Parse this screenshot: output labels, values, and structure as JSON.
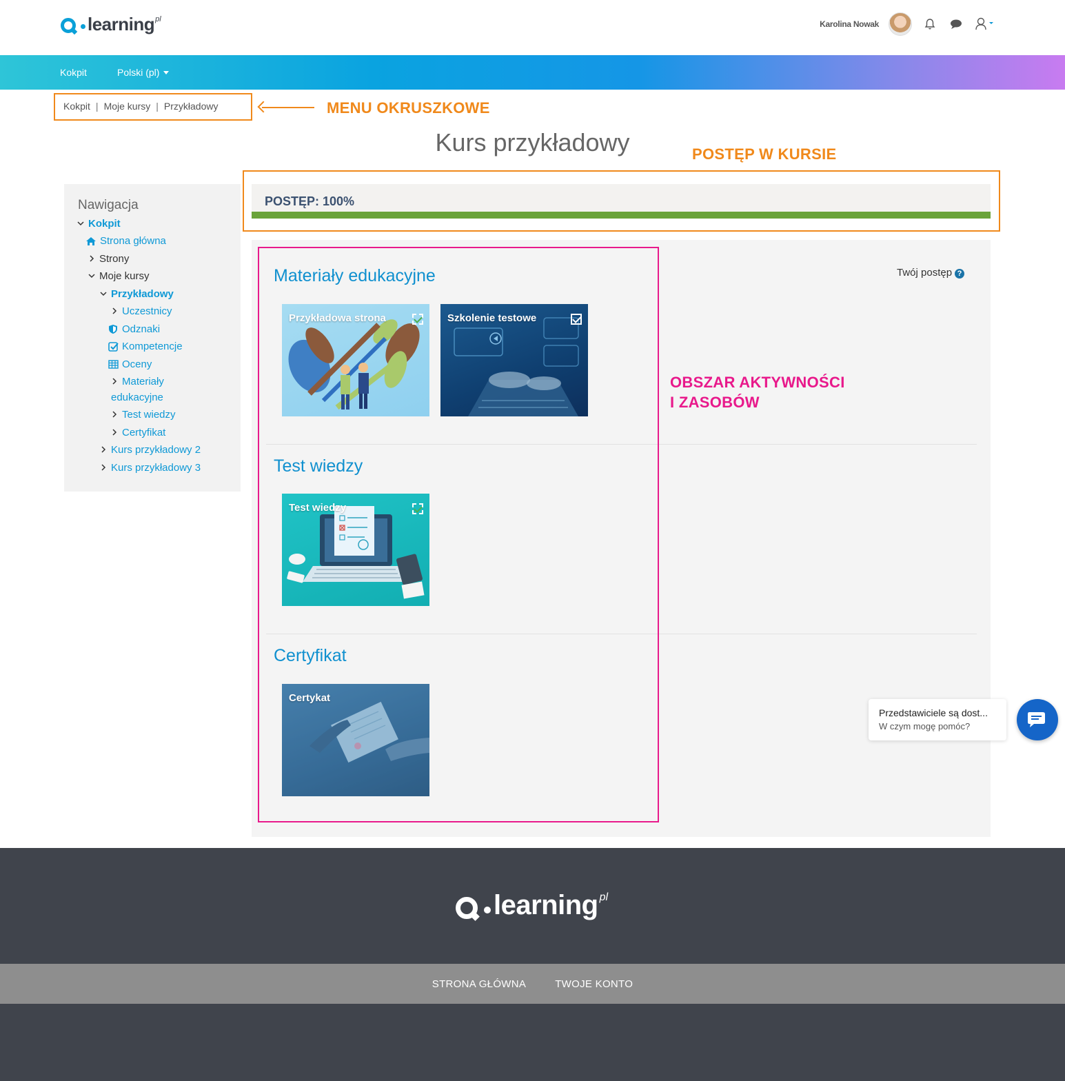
{
  "header": {
    "logo_word": "learning",
    "logo_suffix": "pl",
    "user_name": "Karolina Nowak"
  },
  "navbar": {
    "items": [
      {
        "label": "Kokpit"
      },
      {
        "label": "Polski (pl)"
      }
    ]
  },
  "breadcrumb": {
    "items": [
      "Kokpit",
      "Moje kursy",
      "Przykładowy"
    ]
  },
  "annotations": {
    "breadcrumb": "MENU OKRUSZKOWE",
    "progress": "POSTĘP W KURSIE",
    "activity_line1": "OBSZAR AKTYWNOŚCI",
    "activity_line2": "I ZASOBÓW"
  },
  "page": {
    "title": "Kurs przykładowy"
  },
  "progress": {
    "label": "POSTĘP: 100%",
    "value": 1.0,
    "color": "#6aa33a"
  },
  "sidebar": {
    "title": "Nawigacja",
    "items": [
      {
        "label": "Kokpit"
      },
      {
        "label": "Strona główna"
      },
      {
        "label": "Strony"
      },
      {
        "label": "Moje kursy"
      },
      {
        "label": "Przykładowy"
      },
      {
        "label": "Uczestnicy"
      },
      {
        "label": "Odznaki"
      },
      {
        "label": "Kompetencje"
      },
      {
        "label": "Oceny"
      },
      {
        "label": "Materiały"
      },
      {
        "label": "edukacyjne"
      },
      {
        "label": "Test wiedzy"
      },
      {
        "label": "Certyfikat"
      },
      {
        "label": "Kurs przykładowy 2"
      },
      {
        "label": "Kurs przykładowy 3"
      }
    ]
  },
  "main": {
    "your_progress": "Twój postęp",
    "help": "?",
    "sections": [
      {
        "title": "Materiały edukacyjne",
        "tiles": [
          {
            "label": "Przykładowa strona",
            "completed": true
          },
          {
            "label": "Szkolenie testowe",
            "completed": true
          }
        ]
      },
      {
        "title": "Test wiedzy",
        "tiles": [
          {
            "label": "Test wiedzy",
            "completed": true
          }
        ]
      },
      {
        "title": "Certyfikat",
        "tiles": [
          {
            "label": "Certykat"
          }
        ]
      }
    ]
  },
  "chat": {
    "title": "Przedstawiciele są dost...",
    "subtitle": "W czym mogę pomóc?"
  },
  "footer": {
    "logo_word": "learning",
    "logo_suffix": "pl",
    "links": [
      "STRONA GŁÓWNA",
      "TWOJE KONTO"
    ]
  },
  "colors": {
    "accent_blue": "#0f99d6",
    "annotation_orange": "#f0891b",
    "annotation_pink": "#e8198b",
    "footer_bg": "#40444c"
  }
}
